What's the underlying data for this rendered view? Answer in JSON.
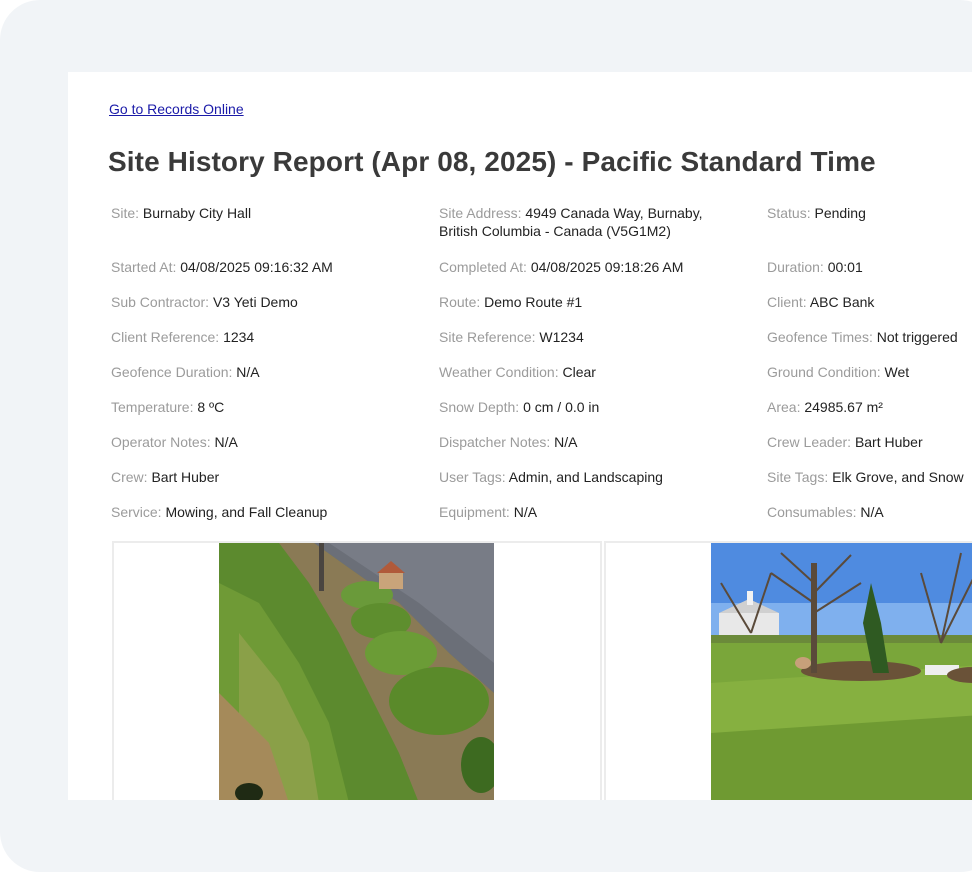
{
  "link": "Go to Records Online",
  "title": "Site History Report (Apr 08, 2025) - Pacific Standard Time",
  "fields": {
    "site": {
      "label": "Site:",
      "value": "Burnaby City Hall"
    },
    "site_address": {
      "label": "Site Address:",
      "value": "4949 Canada Way, Burnaby, British Columbia - Canada (V5G1M2)"
    },
    "status": {
      "label": "Status:",
      "value": "Pending"
    },
    "started_at": {
      "label": "Started At:",
      "value": "04/08/2025 09:16:32 AM"
    },
    "completed_at": {
      "label": "Completed At:",
      "value": "04/08/2025 09:18:26 AM"
    },
    "duration": {
      "label": "Duration:",
      "value": "00:01"
    },
    "sub_contractor": {
      "label": "Sub Contractor:",
      "value": "V3 Yeti Demo"
    },
    "route": {
      "label": "Route:",
      "value": "Demo Route #1"
    },
    "client": {
      "label": "Client:",
      "value": "ABC Bank"
    },
    "client_reference": {
      "label": "Client Reference:",
      "value": "1234"
    },
    "site_reference": {
      "label": "Site Reference:",
      "value": "W1234"
    },
    "geofence_times": {
      "label": "Geofence Times:",
      "value": "Not triggered"
    },
    "geofence_duration": {
      "label": "Geofence Duration:",
      "value": "N/A"
    },
    "weather_condition": {
      "label": "Weather Condition:",
      "value": "Clear"
    },
    "ground_condition": {
      "label": "Ground Condition:",
      "value": "Wet"
    },
    "temperature": {
      "label": "Temperature:",
      "value": "8 ºC"
    },
    "snow_depth": {
      "label": "Snow Depth:",
      "value": "0 cm / 0.0 in"
    },
    "area": {
      "label": "Area:",
      "value": "24985.67 m²"
    },
    "operator_notes": {
      "label": "Operator Notes:",
      "value": "N/A"
    },
    "dispatcher_notes": {
      "label": "Dispatcher Notes:",
      "value": "N/A"
    },
    "crew_leader": {
      "label": "Crew Leader:",
      "value": "Bart Huber"
    },
    "crew": {
      "label": "Crew:",
      "value": "Bart Huber"
    },
    "user_tags": {
      "label": "User Tags:",
      "value": "Admin, and Landscaping"
    },
    "site_tags": {
      "label": "Site Tags:",
      "value": "Elk Grove, and Snow"
    },
    "service": {
      "label": "Service:",
      "value": "Mowing, and Fall Cleanup"
    },
    "equipment": {
      "label": "Equipment:",
      "value": "N/A"
    },
    "consumables": {
      "label": "Consumables:",
      "value": "N/A"
    }
  },
  "colors": {
    "link": "#1a1aa8",
    "label": "#9b9b9b",
    "title": "#3a3a3a",
    "frame_bg": "#f1f4f7"
  }
}
